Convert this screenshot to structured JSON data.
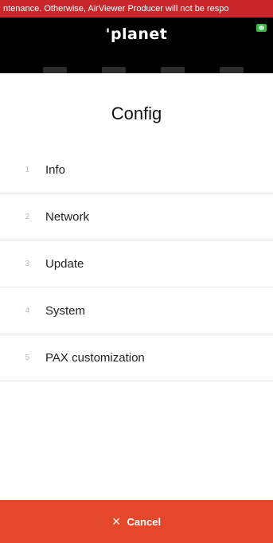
{
  "banner": {
    "text": "ntenance. Otherwise, AirViewer Producer will not be respo"
  },
  "header": {
    "logo_text": "'planet",
    "status_icon": "monitor-icon"
  },
  "page": {
    "title": "Config"
  },
  "menu": {
    "items": [
      {
        "number": "1",
        "label": "Info"
      },
      {
        "number": "2",
        "label": "Network"
      },
      {
        "number": "3",
        "label": "Update"
      },
      {
        "number": "4",
        "label": "System"
      },
      {
        "number": "5",
        "label": "PAX customization"
      }
    ]
  },
  "footer": {
    "cancel_icon": "×",
    "cancel_label": "Cancel"
  },
  "colors": {
    "banner": "#c8262a",
    "header": "#000000",
    "cancel": "#e5472a"
  }
}
